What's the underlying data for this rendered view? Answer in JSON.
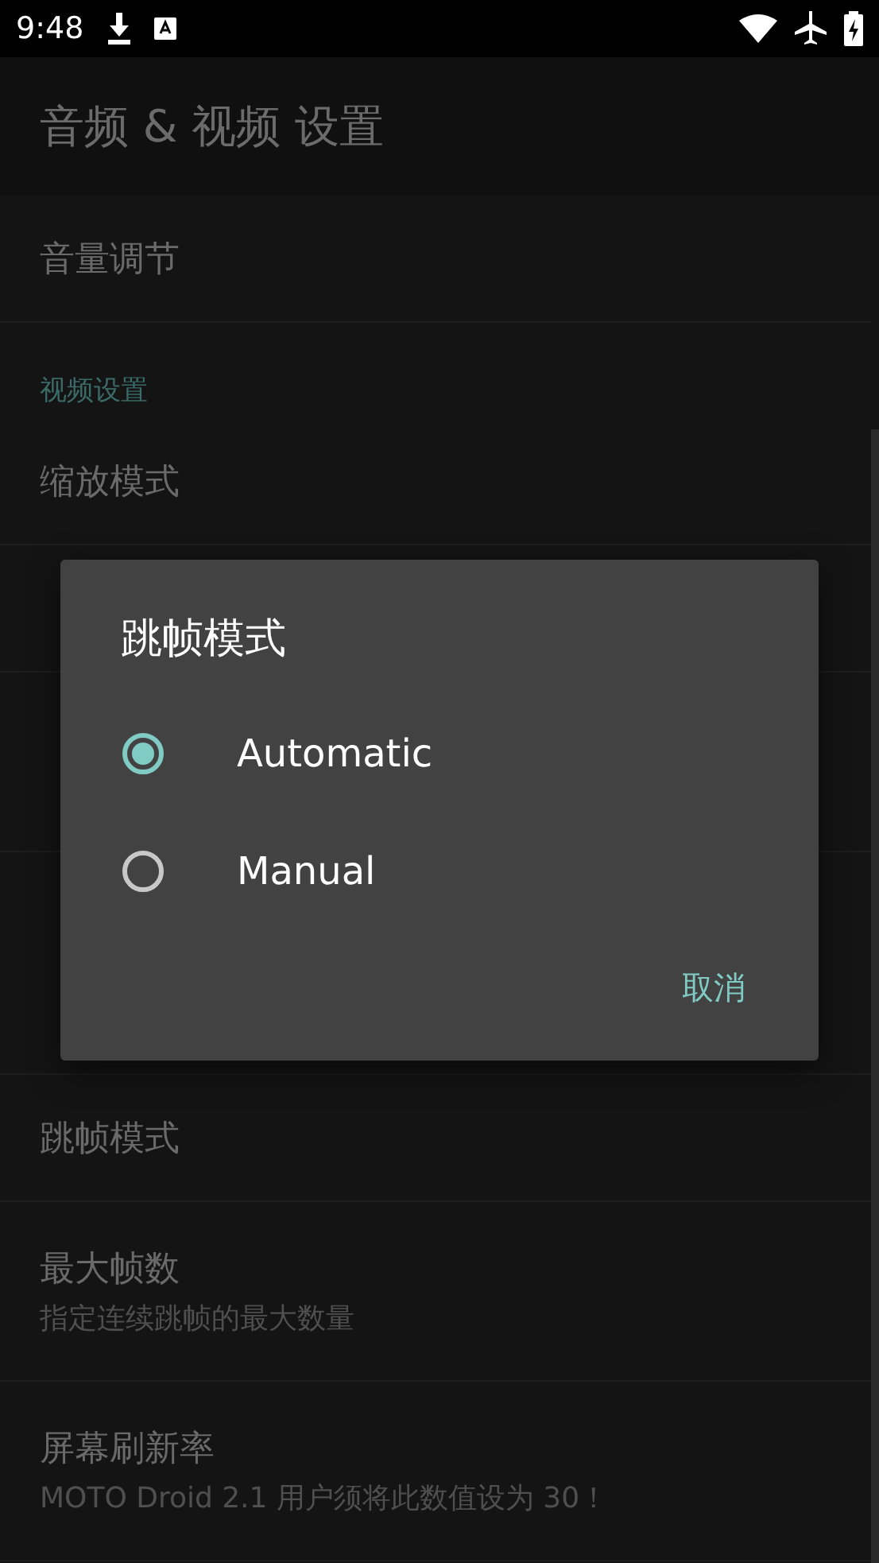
{
  "status_bar": {
    "time": "9:48"
  },
  "app_bar": {
    "title": "音频 & 视频 设置"
  },
  "list": [
    {
      "kind": "item",
      "title": "音量调节"
    },
    {
      "kind": "category",
      "title": "视频设置"
    },
    {
      "kind": "item",
      "title": "缩放模式"
    },
    {
      "kind": "covered"
    },
    {
      "kind": "covered_double"
    },
    {
      "kind": "covered_category"
    },
    {
      "kind": "covered"
    },
    {
      "kind": "item",
      "title": "跳帧模式"
    },
    {
      "kind": "item",
      "title": "最大帧数",
      "summary": "指定连续跳帧的最大数量"
    },
    {
      "kind": "item",
      "title": "屏幕刷新率",
      "summary": "MOTO Droid 2.1 用户须将此数值设为 30！"
    }
  ],
  "dialog": {
    "title": "跳帧模式",
    "options": [
      {
        "label": "Automatic",
        "selected": true
      },
      {
        "label": "Manual",
        "selected": false
      }
    ],
    "buttons": [
      "取消"
    ]
  }
}
